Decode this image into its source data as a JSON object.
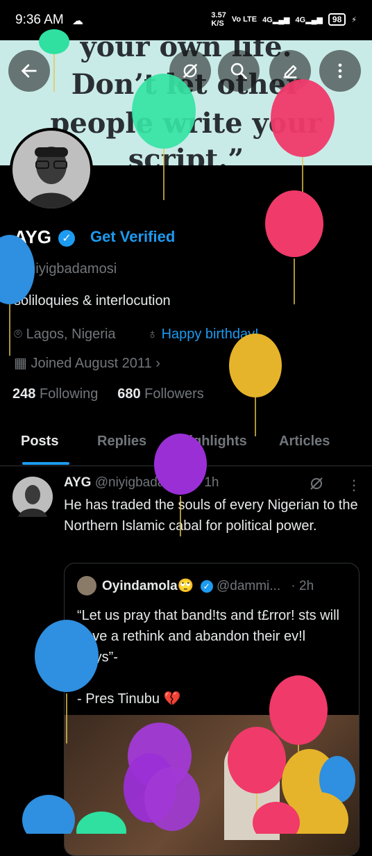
{
  "status": {
    "time": "9:36 AM",
    "speed": "3.57",
    "speed_unit": "K/S",
    "volte": "Vo LTE",
    "net1": "4G",
    "net2": "4G",
    "battery": "98"
  },
  "banner": {
    "lines": [
      "your own life.",
      "Don’t let other",
      "people write your",
      "script.”"
    ]
  },
  "profile": {
    "name": "AYG",
    "get_verified": "Get Verified",
    "handle": "@niyigbadamosi",
    "bio": "soliloquies & interlocution",
    "location": "Lagos, Nigeria",
    "birthday": "Happy birthday!",
    "joined": "Joined August 2011",
    "following_count": "248",
    "following_label": "Following",
    "followers_count": "680",
    "followers_label": "Followers"
  },
  "tabs": [
    "Posts",
    "Replies",
    "Highlights",
    "Articles"
  ],
  "post": {
    "author": "AYG",
    "handle": "@niyigbadamosi",
    "time": "· 1h",
    "text": "He has traded the souls of every Nigerian to the Northern Islamic cabal for political power."
  },
  "quote": {
    "author": "Oyindamola🙄",
    "handle": "@dammi...",
    "time": "· 2h",
    "line1": "“Let us pray that band!ts and t£rror! sts will have a rethink and abandon their ev!l ways”-",
    "line2": "- Pres Tinubu 💔"
  },
  "colors": {
    "accent": "#1d9bf0",
    "muted": "#71767b",
    "text": "#e7e9ea",
    "banner_bg": "#c9ebe8"
  },
  "icons": [
    "back-arrow-icon",
    "grok-icon",
    "search-icon",
    "edit-icon",
    "more-icon",
    "location-icon",
    "balloon-icon",
    "calendar-icon",
    "chevron-right-icon"
  ]
}
